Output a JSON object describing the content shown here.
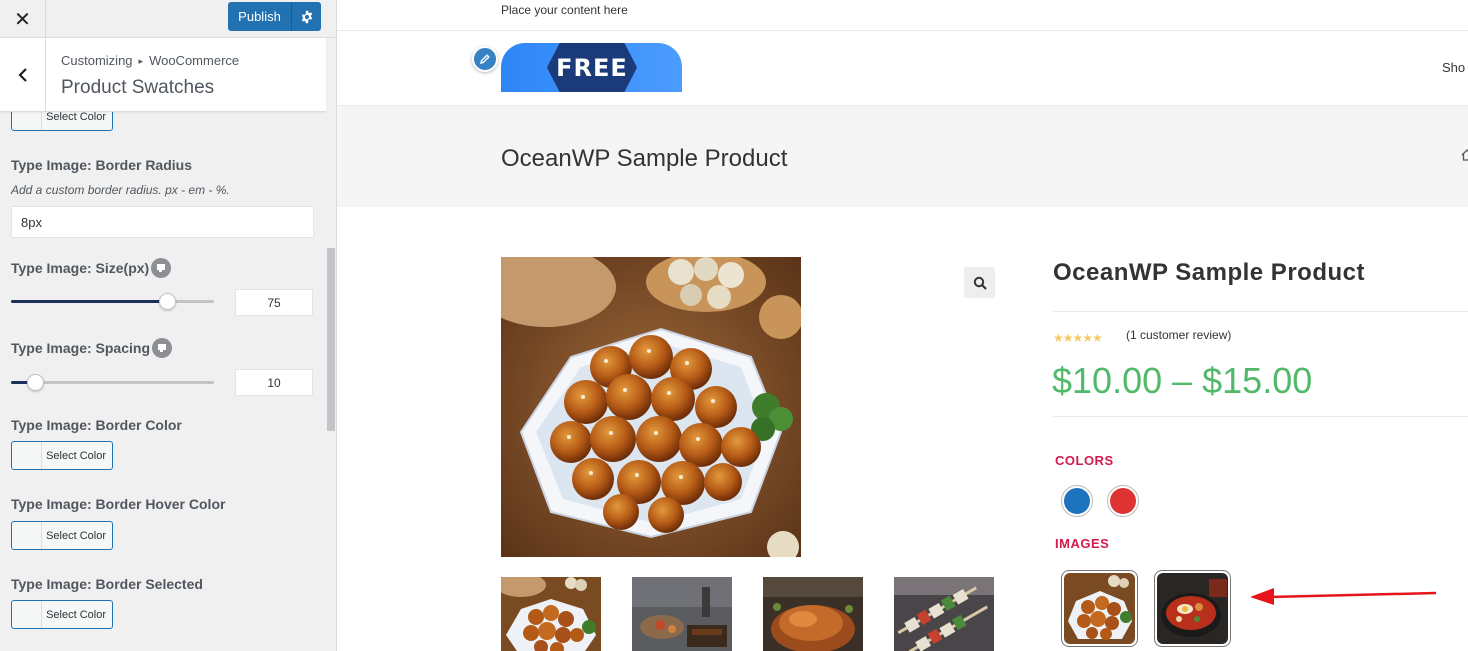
{
  "customizer": {
    "close_label": "✕",
    "publish_label": "Publish",
    "breadcrumb": {
      "root": "Customizing",
      "separator": "▸",
      "parent": "WooCommerce"
    },
    "section_title": "Product Swatches",
    "controls": {
      "top_color_button": "Select Color",
      "border_radius": {
        "label": "Type Image: Border Radius",
        "description": "Add a custom border radius. px - em - %.",
        "value": "8px"
      },
      "size": {
        "label": "Type Image: Size(px)",
        "value": "75",
        "fraction": 0.77
      },
      "spacing": {
        "label": "Type Image: Spacing",
        "value": "10",
        "fraction": 0.12
      },
      "border_color": {
        "label": "Type Image: Border Color",
        "button": "Select Color"
      },
      "border_hover_color": {
        "label": "Type Image: Border Hover Color",
        "button": "Select Color"
      },
      "border_selected": {
        "label": "Type Image: Border Selected",
        "button": "Select Color"
      }
    }
  },
  "preview": {
    "topbar_text": "Place your content here",
    "logo_text": "FREE",
    "nav_partial": "Sho",
    "page_title": "OceanWP Sample Product",
    "product": {
      "title": "OceanWP Sample Product",
      "stars": "★★★★★",
      "rating": 5,
      "review_text": "(1 customer review)",
      "price": "$10.00 – $15.00",
      "colors_label": "COLORS",
      "color_swatches": [
        "#1e73be",
        "#dd3333"
      ],
      "images_label": "IMAGES"
    }
  },
  "colors": {
    "wp_blue": "#2271b1",
    "price_green": "#52b96a",
    "attr_label": "#d21a4f",
    "arrow_red": "#e8141b"
  }
}
